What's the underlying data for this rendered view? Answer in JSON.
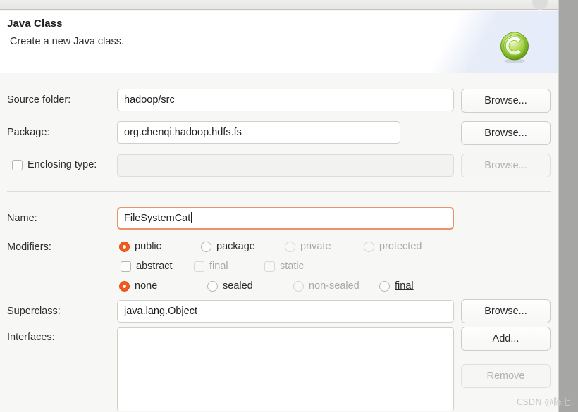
{
  "window": {
    "close_icon": "close-button-circle"
  },
  "header": {
    "title": "Java Class",
    "description": "Create a new Java class.",
    "icon": "java-class-green-c-icon"
  },
  "fields": {
    "source_folder": {
      "label": "Source folder:",
      "value": "hadoop/src",
      "placeholder": "",
      "browse_label": "Browse...",
      "browse_enabled": true
    },
    "package": {
      "label": "Package:",
      "value": "org.chenqi.hadoop.hdfs.fs",
      "placeholder": "",
      "browse_label": "Browse...",
      "browse_enabled": true
    },
    "enclosing_type": {
      "label": "Enclosing type:",
      "checked": false,
      "value": "",
      "placeholder": "",
      "browse_label": "Browse...",
      "browse_enabled": false
    },
    "name": {
      "label": "Name:",
      "value": "FileSystemCat",
      "placeholder": "",
      "focused": true
    },
    "superclass": {
      "label": "Superclass:",
      "value": "java.lang.Object",
      "placeholder": "",
      "browse_label": "Browse...",
      "browse_enabled": true
    },
    "interfaces": {
      "label": "Interfaces:",
      "items": [],
      "add_label": "Add...",
      "add_enabled": true,
      "remove_label": "Remove",
      "remove_enabled": false
    }
  },
  "modifiers": {
    "label": "Modifiers:",
    "access": [
      {
        "label": "public",
        "selected": true,
        "enabled": true
      },
      {
        "label": "package",
        "selected": false,
        "enabled": true
      },
      {
        "label": "private",
        "selected": false,
        "enabled": false
      },
      {
        "label": "protected",
        "selected": false,
        "enabled": false
      }
    ],
    "flags": [
      {
        "label": "abstract",
        "checked": false,
        "enabled": true
      },
      {
        "label": "final",
        "checked": false,
        "enabled": false
      },
      {
        "label": "static",
        "checked": false,
        "enabled": false
      }
    ],
    "sealing": [
      {
        "label": "none",
        "selected": true,
        "enabled": true
      },
      {
        "label": "sealed",
        "selected": false,
        "enabled": true
      },
      {
        "label": "non-sealed",
        "selected": false,
        "enabled": false
      },
      {
        "label": "final",
        "selected": false,
        "enabled": true
      }
    ]
  },
  "watermark": "CSDN @陈七.",
  "colors": {
    "accent": "#ef5c1e",
    "focus_border": "#e8936a",
    "icon_green": "#8dc63f",
    "window_bg": "#f7f7f6",
    "gutter": "#a6a6a4"
  }
}
